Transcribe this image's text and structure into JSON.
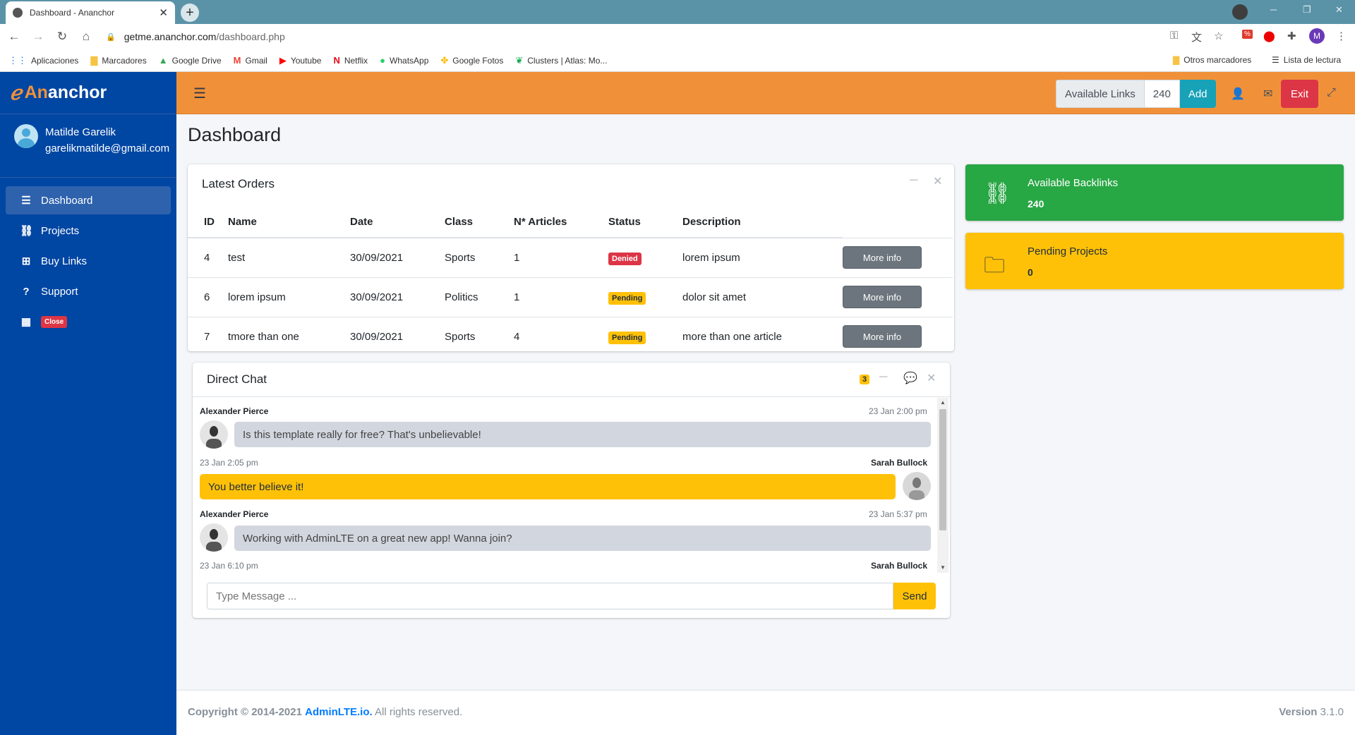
{
  "browser": {
    "tab_title": "Dashboard - Ananchor",
    "tab_close": "✕",
    "new_tab": "+",
    "url_host": "getme.ananchor.com",
    "url_path": "/dashboard.php",
    "bookmarks": [
      {
        "label": "Aplicaciones",
        "icon": "apps-grid-icon",
        "color": "#1a73e8"
      },
      {
        "label": "Marcadores",
        "icon": "folder-icon",
        "color": "#f6c343"
      },
      {
        "label": "Google Drive",
        "icon": "drive-icon",
        "color": "#34a853"
      },
      {
        "label": "Gmail",
        "icon": "gmail-icon",
        "color": "#ea4335"
      },
      {
        "label": "Youtube",
        "icon": "youtube-icon",
        "color": "#ff0000"
      },
      {
        "label": "Netflix",
        "icon": "netflix-icon",
        "color": "#e50914"
      },
      {
        "label": "WhatsApp",
        "icon": "whatsapp-icon",
        "color": "#25d366"
      },
      {
        "label": "Google Fotos",
        "icon": "photos-icon",
        "color": "#fbbc04"
      },
      {
        "label": "Clusters | Atlas: Mo...",
        "icon": "leaf-icon",
        "color": "#13aa52"
      }
    ],
    "other_bookmarks": "Otros marcadores",
    "reading_list": "Lista de lectura",
    "profile_initial": "M"
  },
  "sidebar": {
    "brand_prefix": "An",
    "brand_suffix": "anchor",
    "user_name": "Matilde Garelik",
    "user_email": "garelikmatilde@gmail.com",
    "items": [
      {
        "label": "Dashboard",
        "icon": "bars-icon",
        "glyph": "☰"
      },
      {
        "label": "Projects",
        "icon": "link-icon",
        "glyph": "🔗"
      },
      {
        "label": "Buy Links",
        "icon": "plus-square-icon",
        "glyph": "⊞"
      },
      {
        "label": "Support",
        "icon": "question-icon",
        "glyph": "?"
      }
    ],
    "close_badge": "Close"
  },
  "topbar": {
    "available_label": "Available Links",
    "available_value": "240",
    "add_label": "Add",
    "exit_label": "Exit"
  },
  "page_title": "Dashboard",
  "orders": {
    "title": "Latest Orders",
    "columns": [
      "ID",
      "Name",
      "Date",
      "Class",
      "N* Articles",
      "Status",
      "Description"
    ],
    "rows": [
      {
        "id": "4",
        "name": "test",
        "date": "30/09/2021",
        "class": "Sports",
        "articles": "1",
        "status": "Denied",
        "description": "lorem ipsum",
        "action": "More info"
      },
      {
        "id": "6",
        "name": "lorem ipsum",
        "date": "30/09/2021",
        "class": "Politics",
        "articles": "1",
        "status": "Pending",
        "description": "dolor sit amet",
        "action": "More info"
      },
      {
        "id": "7",
        "name": "tmore than one",
        "date": "30/09/2021",
        "class": "Sports",
        "articles": "4",
        "status": "Pending",
        "description": "more than one article",
        "action": "More info"
      }
    ]
  },
  "chat": {
    "title": "Direct Chat",
    "badge": "3",
    "messages": [
      {
        "name": "Alexander Pierce",
        "time": "23 Jan 2:00 pm",
        "text": "Is this template really for free? That's unbelievable!",
        "side": "left"
      },
      {
        "name": "Sarah Bullock",
        "time": "23 Jan 2:05 pm",
        "text": "You better believe it!",
        "side": "right"
      },
      {
        "name": "Alexander Pierce",
        "time": "23 Jan 5:37 pm",
        "text": "Working with AdminLTE on a great new app! Wanna join?",
        "side": "left"
      },
      {
        "name": "Sarah Bullock",
        "time": "23 Jan 6:10 pm",
        "text": "",
        "side": "right"
      }
    ],
    "input_placeholder": "Type Message ...",
    "send_label": "Send"
  },
  "info_boxes": [
    {
      "label": "Available Backlinks",
      "value": "240",
      "icon": "link-icon",
      "color": "#28a745"
    },
    {
      "label": "Pending Projects",
      "value": "0",
      "icon": "folder-icon",
      "color": "#ffc107"
    }
  ],
  "footer": {
    "copyright": "Copyright © 2014-2021",
    "link": "AdminLTE.io.",
    "rights": "All rights reserved.",
    "version_label": "Version",
    "version_value": "3.1.0"
  },
  "colors": {
    "sidebar": "#0046a3",
    "topbar": "#f0913a",
    "accent": "#17a2b8",
    "danger": "#dc3545",
    "warning": "#ffc107",
    "success": "#28a745"
  }
}
